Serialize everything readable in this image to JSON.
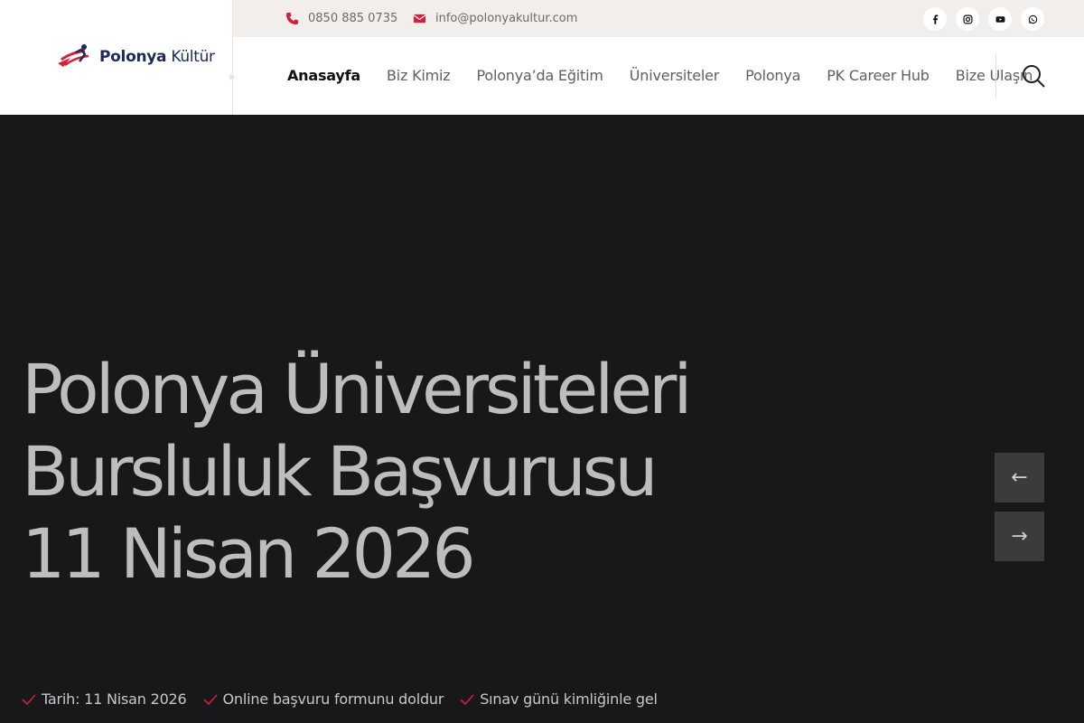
{
  "header": {
    "logo": {
      "brand": "Polonya",
      "suffix": "Kültür"
    },
    "contact": {
      "phone": "0850 885 0735",
      "email": "info@polonyakultur.com"
    },
    "socials": [
      "facebook-icon",
      "instagram-icon",
      "youtube-icon",
      "whatsapp-icon"
    ],
    "nav": [
      {
        "label": "Anasayfa",
        "active": true
      },
      {
        "label": "Biz Kimiz"
      },
      {
        "label": "Polonya’da Eğitim"
      },
      {
        "label": "Üniversiteler"
      },
      {
        "label": "Polonya"
      },
      {
        "label": "PK Career Hub"
      },
      {
        "label": "Bize Ulaşın"
      }
    ]
  },
  "hero": {
    "title_lines": [
      "Polonya Üniversiteleri",
      "Bursluluk Başvurusu",
      "11 Nisan 2026"
    ],
    "checks": [
      "Tarih: 11 Nisan 2026",
      "Online başvuru formunu doldur",
      "Sınav günü kimliğinle gel"
    ],
    "prev_symbol": "←",
    "next_symbol": "→"
  },
  "colors": {
    "accent": "#d2213a",
    "hero_bg": "#18181b",
    "topbar_bg": "#f1eeeb"
  }
}
